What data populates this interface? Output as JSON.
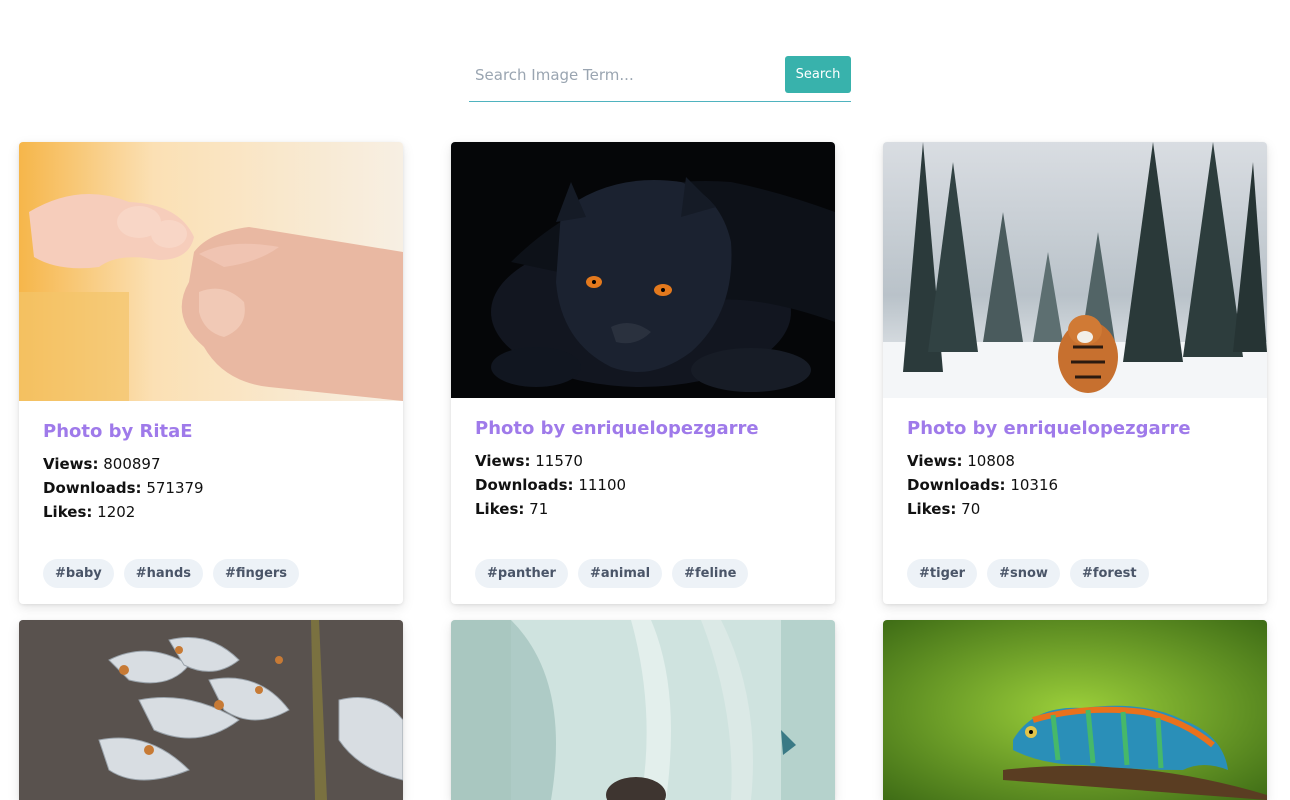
{
  "search": {
    "placeholder": "Search Image Term...",
    "button_label": "Search"
  },
  "labels": {
    "views": "Views:",
    "downloads": "Downloads:",
    "likes": "Likes:"
  },
  "cards": [
    {
      "title": "Photo by RitaE",
      "views": "800897",
      "downloads": "571379",
      "likes": "1202",
      "tags": [
        "#baby",
        "#hands",
        "#fingers"
      ],
      "image": "baby-hand-photo"
    },
    {
      "title": "Photo by enriquelopezgarre",
      "views": "11570",
      "downloads": "11100",
      "likes": "71",
      "tags": [
        "#panther",
        "#animal",
        "#feline"
      ],
      "image": "black-panther-photo"
    },
    {
      "title": "Photo by enriquelopezgarre",
      "views": "10808",
      "downloads": "10316",
      "likes": "70",
      "tags": [
        "#tiger",
        "#snow",
        "#forest"
      ],
      "image": "tiger-snow-forest-photo"
    },
    {
      "image": "frozen-flower-photo"
    },
    {
      "image": "painted-curtain-photo"
    },
    {
      "image": "chameleon-photo"
    }
  ]
}
